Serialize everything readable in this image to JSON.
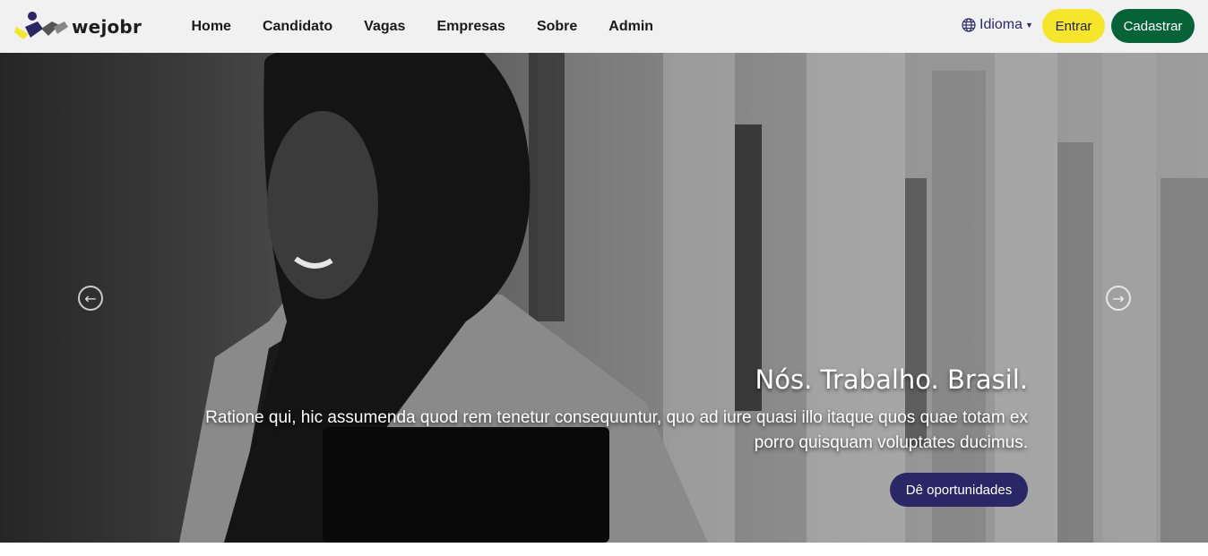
{
  "brand": {
    "name": "wejobr",
    "logo_icon": "wejobr-logo"
  },
  "nav": {
    "links": [
      "Home",
      "Candidato",
      "Vagas",
      "Empresas",
      "Sobre",
      "Admin"
    ],
    "language": {
      "label": "Idioma",
      "icon": "globe-icon"
    },
    "login_label": "Entrar",
    "signup_label": "Cadastrar"
  },
  "hero": {
    "title": "Nós. Trabalho. Brasil.",
    "text": "Ratione qui, hic assumenda quod rem tenetur consequuntur, quo ad iure quasi illo itaque quos quae totam ex porro quisquam voluptates ducimus.",
    "cta_label": "Dê oportunidades",
    "prev_icon": "arrow-left-circle-icon",
    "next_icon": "arrow-right-circle-icon"
  },
  "colors": {
    "navbar_bg": "#f1f1f1",
    "login_bg": "#f6e62b",
    "signup_bg": "#056337",
    "cta_bg": "#2a2766",
    "link_color": "#2e2a6b"
  }
}
